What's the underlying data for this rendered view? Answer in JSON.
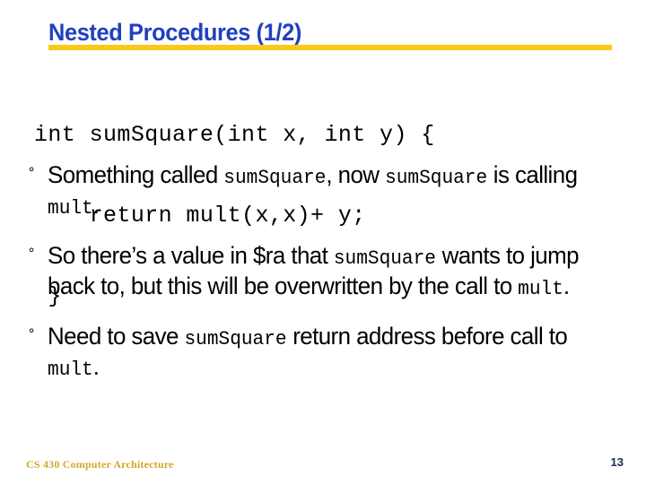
{
  "slide": {
    "title": "Nested Procedures (1/2)",
    "accent_blue": "#2040c0",
    "accent_gold": "#fcc81a",
    "footer_gold": "#d2a82a",
    "page_number_color": "#1b2a52",
    "background": "#ffffff"
  },
  "code": {
    "line1": "int sumSquare(int x, int y) {",
    "line2": "    return mult(x,x)+ y;",
    "line3": " }"
  },
  "bullets": [
    {
      "marker": "°",
      "parts": [
        {
          "text": "Something called ",
          "style": "sans"
        },
        {
          "text": "sumSquare",
          "style": "mono"
        },
        {
          "text": ", now ",
          "style": "sans"
        },
        {
          "text": "sumSquare",
          "style": "mono"
        },
        {
          "text": " is calling ",
          "style": "sans"
        },
        {
          "text": "mult",
          "style": "mono"
        },
        {
          "text": ".",
          "style": "sans"
        }
      ]
    },
    {
      "marker": "°",
      "parts": [
        {
          "text": "So there’s a value in $ra that ",
          "style": "sans"
        },
        {
          "text": "sumSquare",
          "style": "mono"
        },
        {
          "text": " wants to jump back to, but this will be overwritten by the call to ",
          "style": "sans"
        },
        {
          "text": "mult",
          "style": "mono"
        },
        {
          "text": ".",
          "style": "sans"
        }
      ]
    },
    {
      "marker": "°",
      "parts": [
        {
          "text": "Need to save ",
          "style": "sans"
        },
        {
          "text": "sumSquare",
          "style": "mono"
        },
        {
          "text": " return address before call to ",
          "style": "sans"
        },
        {
          "text": "mult",
          "style": "mono"
        },
        {
          "text": ".",
          "style": "sans"
        }
      ]
    }
  ],
  "footer": {
    "course": "CS 430 Computer Architecture",
    "page_number": "13"
  }
}
